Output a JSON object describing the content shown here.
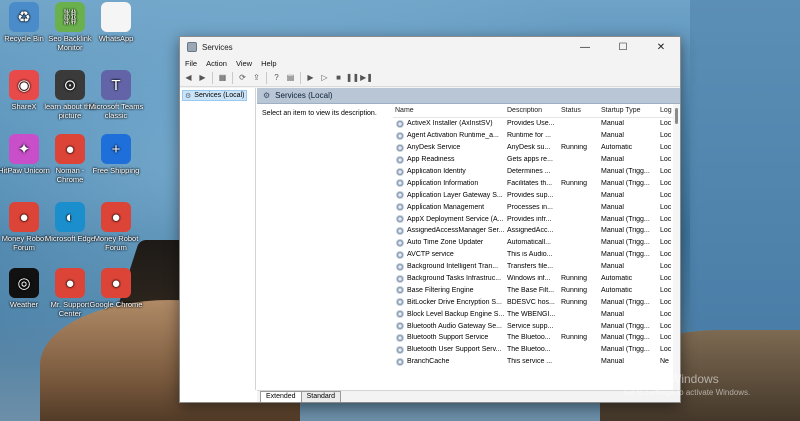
{
  "desktop": {
    "icons": [
      {
        "label": "Recycle Bin",
        "icon": "recycle-bin-icon",
        "glyph": "♻",
        "color": "#4a8cc9"
      },
      {
        "label": "Seo Backlink Monitor",
        "icon": "seo-backlink-icon",
        "glyph": "⛓",
        "color": "#6ab04c"
      },
      {
        "label": "WhatsApp",
        "icon": "whatsapp-file-icon",
        "glyph": "",
        "color": "#f5f5f5"
      },
      {
        "label": "ShareX",
        "icon": "sharex-icon",
        "glyph": "◉",
        "color": "#e84a4a"
      },
      {
        "label": "learn about this picture",
        "icon": "learn-about-picture-icon",
        "glyph": "⊙",
        "color": "#3a3a3a"
      },
      {
        "label": "Microsoft Teams classic",
        "icon": "teams-icon",
        "glyph": "T",
        "color": "#6264a7"
      },
      {
        "label": "HitPaw Unicorn",
        "icon": "hitpaw-icon",
        "glyph": "✦",
        "color": "#c94ec9"
      },
      {
        "label": "Noman - Chrome",
        "icon": "chrome-icon",
        "glyph": "●",
        "color": "#db4437"
      },
      {
        "label": "Free Shipping",
        "icon": "plus-icon",
        "glyph": "+",
        "color": "#1e6fd9"
      },
      {
        "label": "Money Robot Forum",
        "icon": "chrome-icon",
        "glyph": "●",
        "color": "#db4437"
      },
      {
        "label": "Microsoft Edge",
        "icon": "edge-icon",
        "glyph": "◐",
        "color": "#1b8fce"
      },
      {
        "label": "Money Robot Forum",
        "icon": "chrome-icon",
        "glyph": "●",
        "color": "#db4437"
      },
      {
        "label": "Weather",
        "icon": "weather-icon",
        "glyph": "◎",
        "color": "#111111"
      },
      {
        "label": "Mr. Support Center",
        "icon": "chrome-icon",
        "glyph": "●",
        "color": "#db4437"
      },
      {
        "label": "Google Chrome",
        "icon": "chrome-icon",
        "glyph": "●",
        "color": "#db4437"
      }
    ]
  },
  "window": {
    "title": "Services",
    "minimize": "—",
    "maximize": "☐",
    "close": "✕",
    "menu": [
      "File",
      "Action",
      "View",
      "Help"
    ],
    "tree_item": "Services (Local)",
    "main_header": "Services (Local)",
    "description_text": "Select an item to view its description.",
    "columns": [
      "Name",
      "Description",
      "Status",
      "Startup Type",
      "Log"
    ],
    "rows": [
      {
        "name": "ActiveX Installer (AxInstSV)",
        "desc": "Provides Use...",
        "status": "",
        "startup": "Manual",
        "log": "Loc"
      },
      {
        "name": "Agent Activation Runtime_a...",
        "desc": "Runtime for ...",
        "status": "",
        "startup": "Manual",
        "log": "Loc"
      },
      {
        "name": "AnyDesk Service",
        "desc": "AnyDesk su...",
        "status": "Running",
        "startup": "Automatic",
        "log": "Loc"
      },
      {
        "name": "App Readiness",
        "desc": "Gets apps re...",
        "status": "",
        "startup": "Manual",
        "log": "Loc"
      },
      {
        "name": "Application Identity",
        "desc": "Determines ...",
        "status": "",
        "startup": "Manual (Trigg...",
        "log": "Loc"
      },
      {
        "name": "Application Information",
        "desc": "Facilitates th...",
        "status": "Running",
        "startup": "Manual (Trigg...",
        "log": "Loc"
      },
      {
        "name": "Application Layer Gateway S...",
        "desc": "Provides sup...",
        "status": "",
        "startup": "Manual",
        "log": "Loc"
      },
      {
        "name": "Application Management",
        "desc": "Processes in...",
        "status": "",
        "startup": "Manual",
        "log": "Loc"
      },
      {
        "name": "AppX Deployment Service (A...",
        "desc": "Provides infr...",
        "status": "",
        "startup": "Manual (Trigg...",
        "log": "Loc"
      },
      {
        "name": "AssignedAccessManager Ser...",
        "desc": "AssignedAcc...",
        "status": "",
        "startup": "Manual (Trigg...",
        "log": "Loc"
      },
      {
        "name": "Auto Time Zone Updater",
        "desc": "Automaticall...",
        "status": "",
        "startup": "Manual (Trigg...",
        "log": "Loc"
      },
      {
        "name": "AVCTP service",
        "desc": "This is Audio...",
        "status": "",
        "startup": "Manual (Trigg...",
        "log": "Loc"
      },
      {
        "name": "Background Intelligent Tran...",
        "desc": "Transfers file...",
        "status": "",
        "startup": "Manual",
        "log": "Loc"
      },
      {
        "name": "Background Tasks Infrastruc...",
        "desc": "Windows inf...",
        "status": "Running",
        "startup": "Automatic",
        "log": "Loc"
      },
      {
        "name": "Base Filtering Engine",
        "desc": "The Base Filt...",
        "status": "Running",
        "startup": "Automatic",
        "log": "Loc"
      },
      {
        "name": "BitLocker Drive Encryption S...",
        "desc": "BDESVC hos...",
        "status": "Running",
        "startup": "Manual (Trigg...",
        "log": "Loc"
      },
      {
        "name": "Block Level Backup Engine S...",
        "desc": "The WBENGI...",
        "status": "",
        "startup": "Manual",
        "log": "Loc"
      },
      {
        "name": "Bluetooth Audio Gateway Se...",
        "desc": "Service supp...",
        "status": "",
        "startup": "Manual (Trigg...",
        "log": "Loc"
      },
      {
        "name": "Bluetooth Support Service",
        "desc": "The Bluetoo...",
        "status": "Running",
        "startup": "Manual (Trigg...",
        "log": "Loc"
      },
      {
        "name": "Bluetooth User Support Serv...",
        "desc": "The Bluetoo...",
        "status": "",
        "startup": "Manual (Trigg...",
        "log": "Loc"
      },
      {
        "name": "BranchCache",
        "desc": "This service ...",
        "status": "",
        "startup": "Manual",
        "log": "Ne"
      }
    ],
    "tabs": [
      "Extended",
      "Standard"
    ]
  },
  "watermark": {
    "line1": "Activate Windows",
    "line2": "Go to Settings to activate Windows."
  }
}
